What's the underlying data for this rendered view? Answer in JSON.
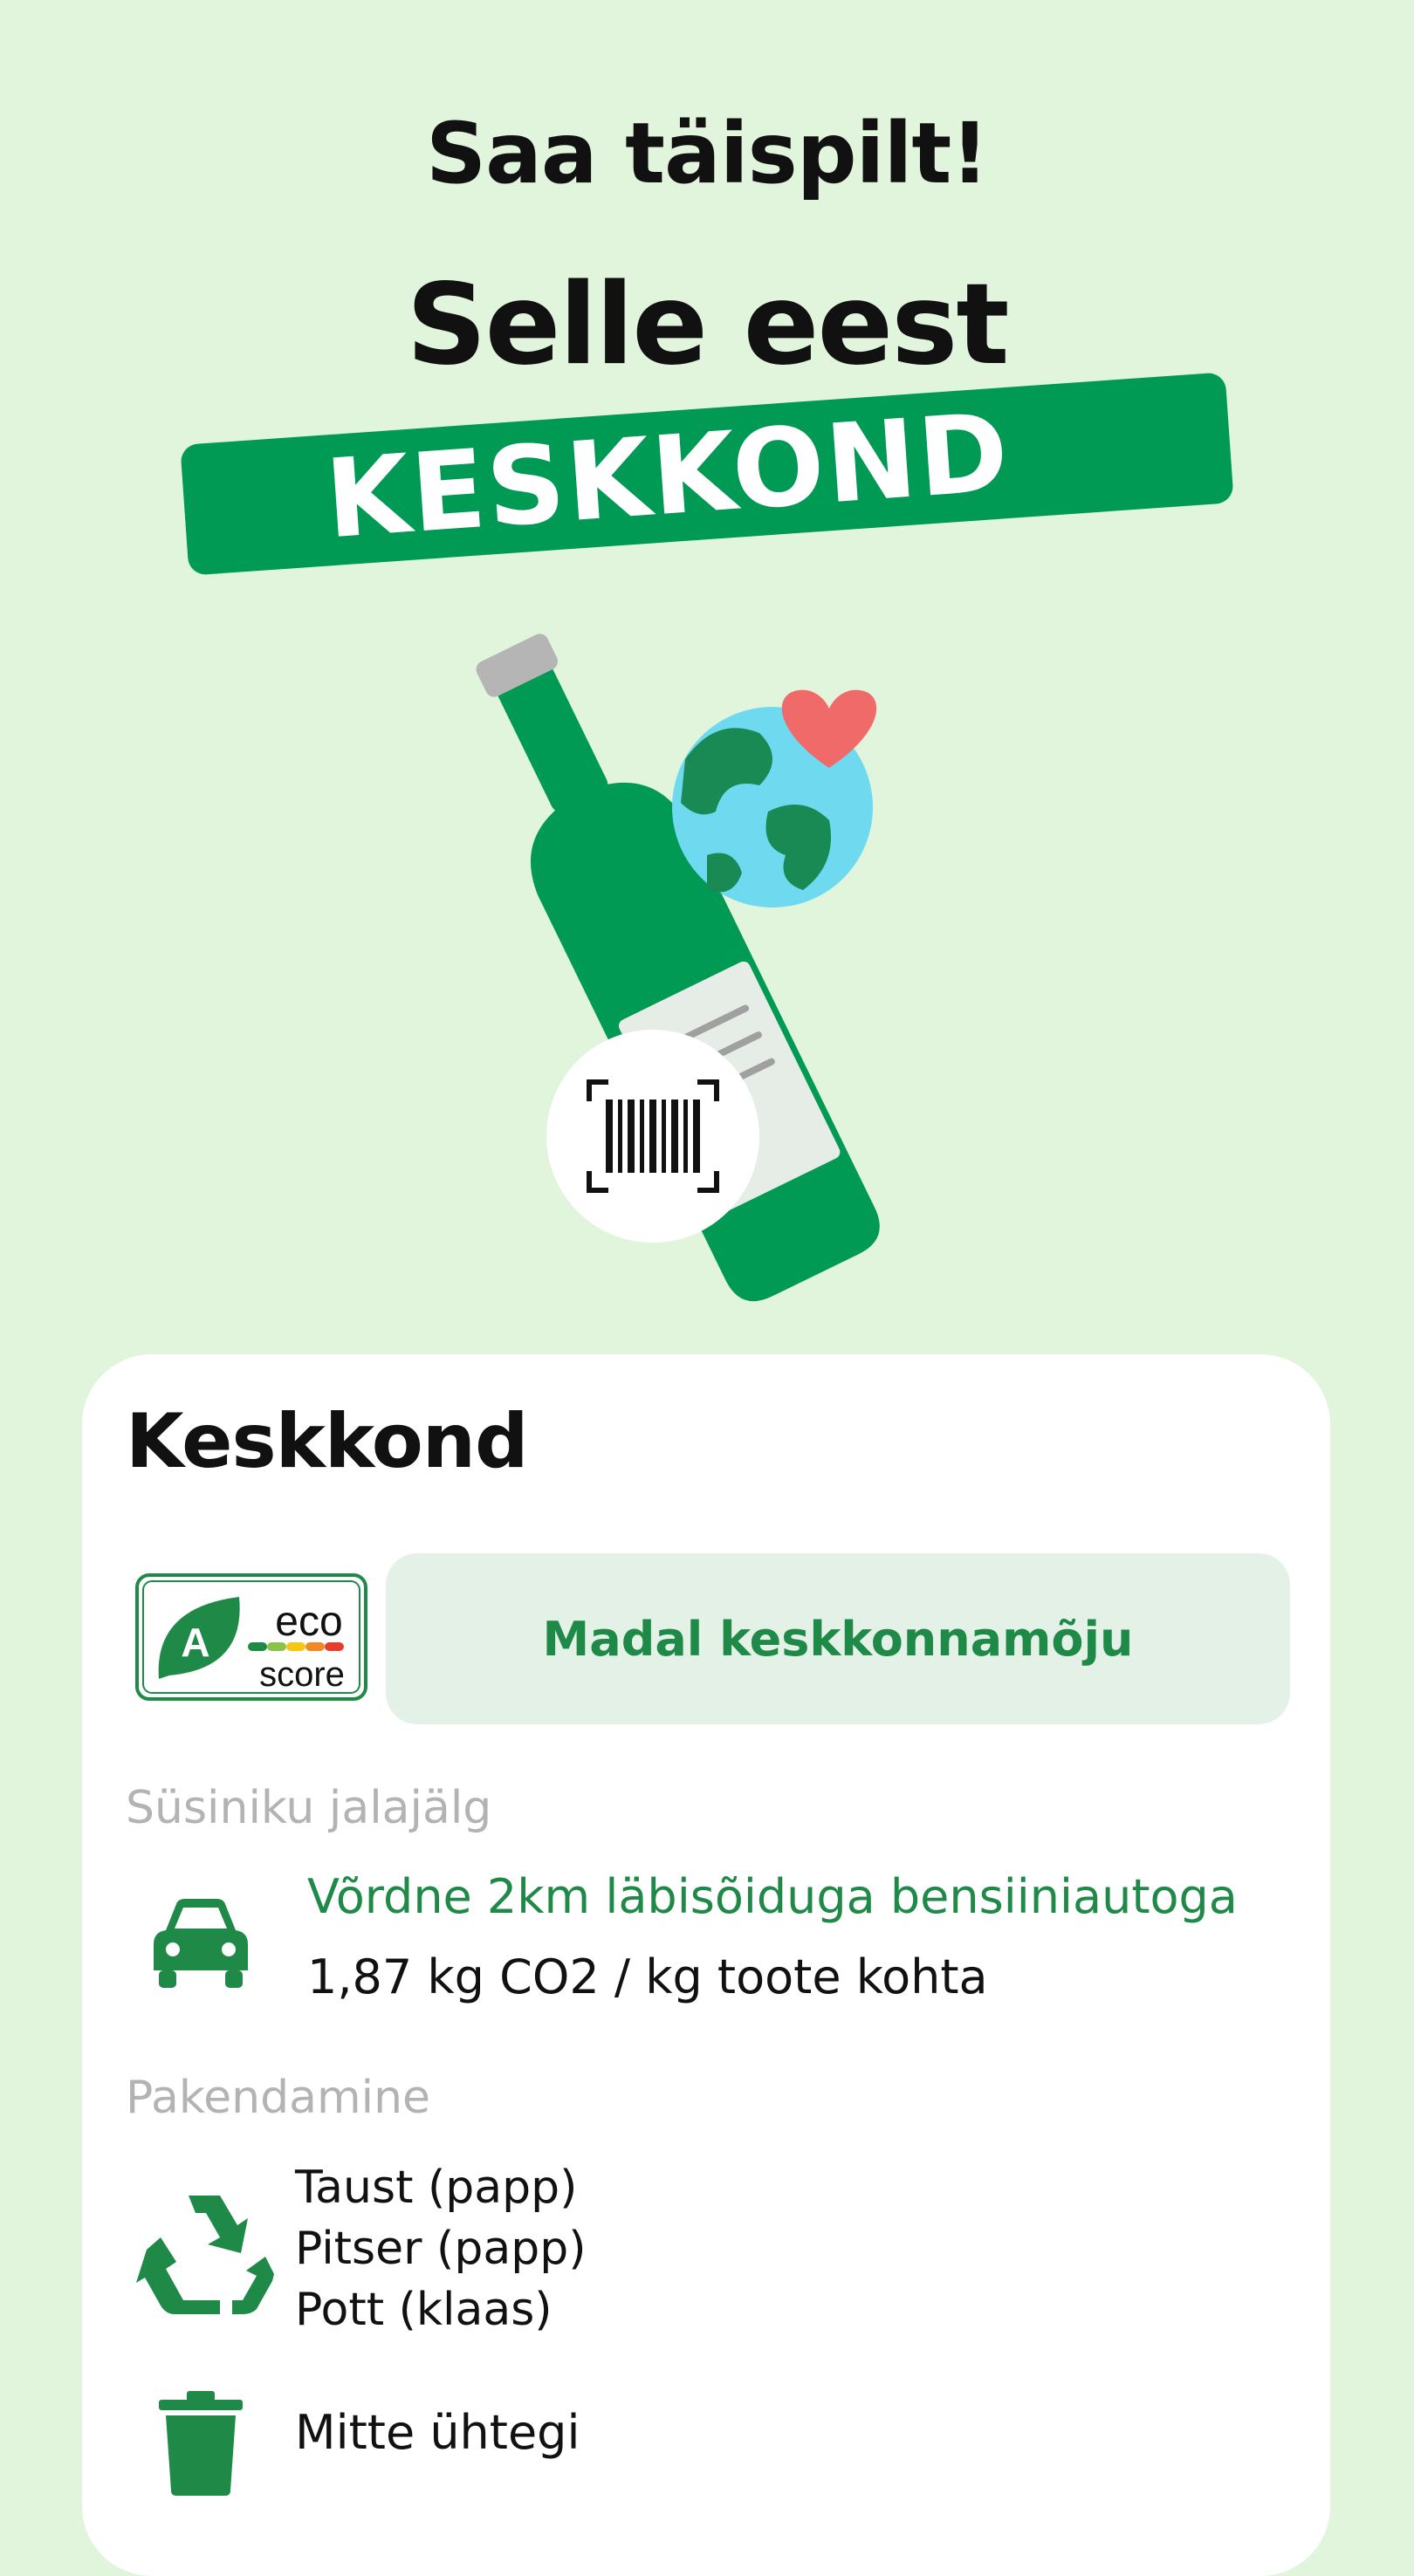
{
  "hero": {
    "title": "Saa täispilt!",
    "subtitle": "Selle eest",
    "banner": "KESKKOND"
  },
  "environment_card": {
    "title": "Keskkond",
    "eco_score": {
      "grade": "A",
      "word1": "eco",
      "word2": "score",
      "impact": "Madal keskkonnamõju"
    },
    "carbon": {
      "label": "Süsiniku jalajälg",
      "equivalent": "Võrdne 2km läbisõiduga bensiiniautoga",
      "value": "1,87 kg CO2 / kg toote kohta"
    },
    "packaging": {
      "label": "Pakendamine",
      "recyclable": [
        "Taust (papp)",
        "Pitser (papp)",
        "Pott (klaas)"
      ],
      "non_recyclable": "Mitte ühtegi"
    }
  },
  "colors": {
    "background": "#e1f5dc",
    "brand_green": "#019a55",
    "text_green": "#1f8a48",
    "pill_bg": "#e3f1e6",
    "muted": "#b3b3b3"
  },
  "icons": [
    "bottle-illustration",
    "globe-icon",
    "heart-icon",
    "barcode-scan-icon",
    "eco-score-leaf-icon",
    "car-icon",
    "recycle-icon",
    "trash-icon"
  ]
}
